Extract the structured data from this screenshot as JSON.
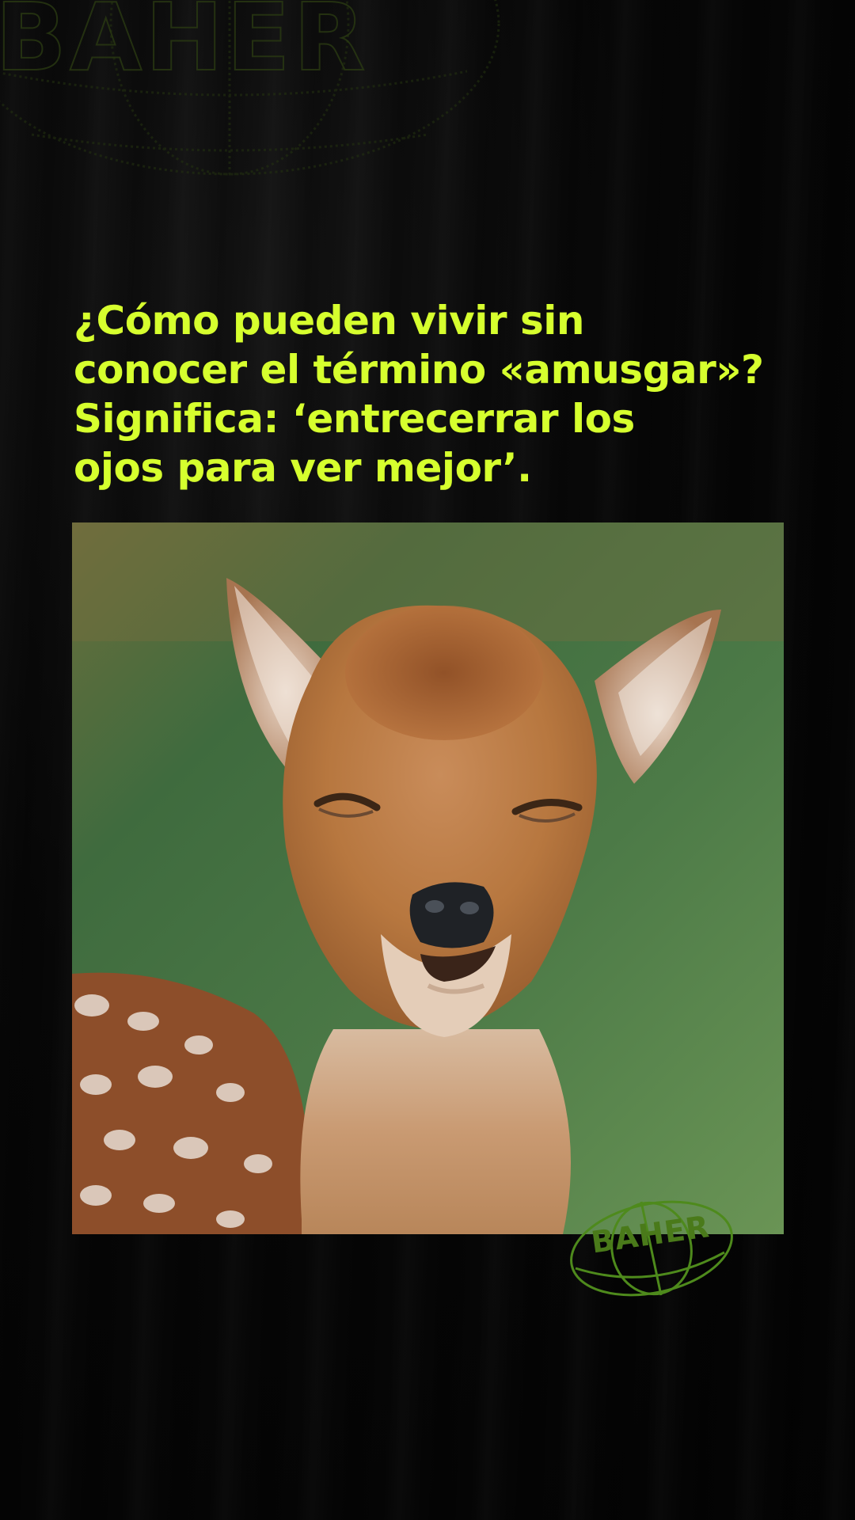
{
  "headline": {
    "line1": "¿Cómo pueden vivir sin",
    "line2": "conocer el término «amusgar»?",
    "line3": "Significa: ‘entrecerrar los",
    "line4": "ojos para ver mejor’."
  },
  "watermark": {
    "brand": "BAHER",
    "color": "#5c8f1e"
  },
  "accent_color": "#d6ff2e",
  "photo": {
    "subject": "fawn squinting"
  }
}
